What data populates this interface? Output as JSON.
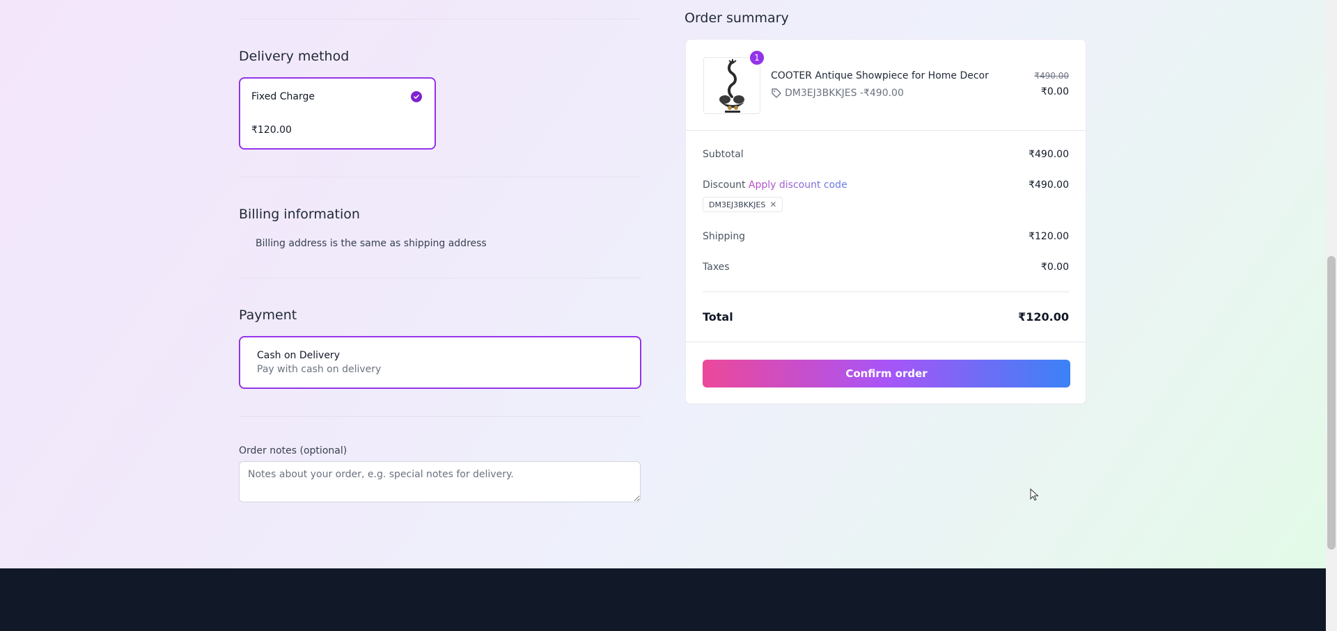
{
  "delivery": {
    "title": "Delivery method",
    "option_name": "Fixed Charge",
    "option_price": "₹120.00"
  },
  "billing": {
    "title": "Billing information",
    "same_as_shipping_label": "Billing address is the same as shipping address"
  },
  "payment": {
    "title": "Payment",
    "option_name": "Cash on Delivery",
    "option_desc": "Pay with cash on delivery"
  },
  "notes": {
    "label": "Order notes (optional)",
    "placeholder": "Notes about your order, e.g. special notes for delivery."
  },
  "summary": {
    "title": "Order summary",
    "item": {
      "quantity": "1",
      "name": "COOTER Antique Showpiece for Home Decor",
      "code_line": "DM3EJ3BKKJES -₹490.00",
      "original_price": "₹490.00",
      "price": "₹0.00"
    },
    "subtotal_label": "Subtotal",
    "subtotal_value": "₹490.00",
    "discount_label": "Discount",
    "apply_discount_link": "Apply discount code",
    "discount_value": "₹490.00",
    "discount_code": "DM3EJ3BKKJES",
    "shipping_label": "Shipping",
    "shipping_value": "₹120.00",
    "taxes_label": "Taxes",
    "taxes_value": "₹0.00",
    "total_label": "Total",
    "total_value": "₹120.00",
    "confirm_label": "Confirm order"
  },
  "colors": {
    "accent": "#9333ea",
    "button_gradient_start": "#ec4899",
    "button_gradient_end": "#3b82f6",
    "footer": "#111827"
  }
}
